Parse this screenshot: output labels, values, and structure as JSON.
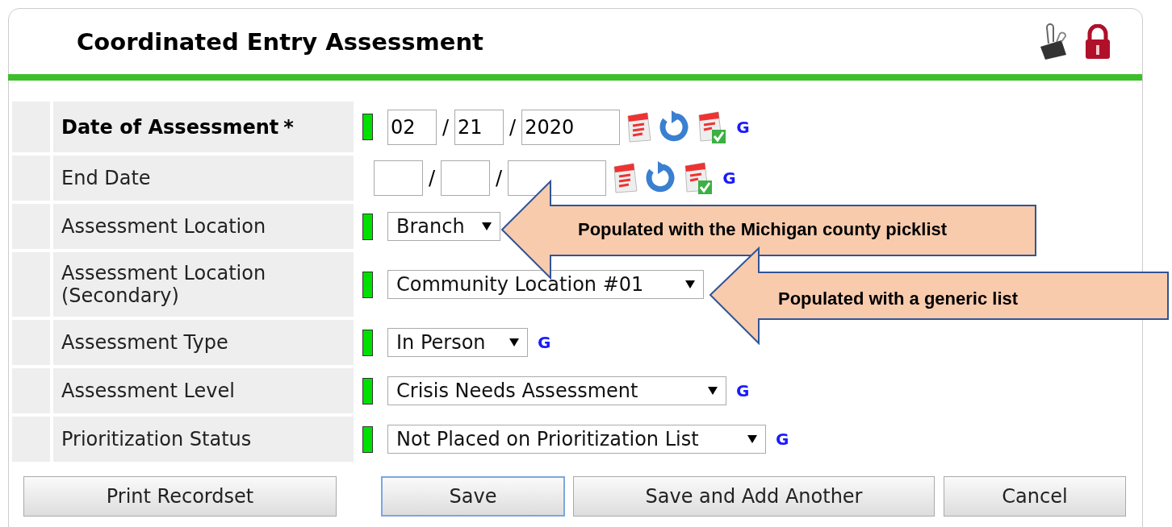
{
  "header": {
    "title": "Coordinated Entry Assessment"
  },
  "fields": [
    {
      "kind": "date",
      "label": "Date of Assessment",
      "asterisk": "*",
      "required": true,
      "month": "02",
      "day": "21",
      "year": "2020",
      "separators": [
        "/",
        "/"
      ],
      "g": "G"
    },
    {
      "kind": "date",
      "label": "End Date",
      "required": false,
      "separators": [
        "/",
        "/"
      ],
      "g": "G"
    },
    {
      "kind": "select",
      "label": "Assessment Location",
      "required": true,
      "value": "Branch"
    },
    {
      "kind": "select",
      "label": "Assessment Location (Secondary)",
      "required": true,
      "value": "Community Location #01"
    },
    {
      "kind": "select",
      "label": "Assessment Type",
      "required": true,
      "value": "In Person",
      "g": "G"
    },
    {
      "kind": "select",
      "label": "Assessment Level",
      "required": true,
      "value": "Crisis Needs Assessment",
      "g": "G"
    },
    {
      "kind": "select",
      "label": "Prioritization Status",
      "required": true,
      "value": "Not Placed on Prioritization List",
      "g": "G"
    }
  ],
  "buttons": [
    {
      "label": "Print Recordset",
      "focused": false
    },
    {
      "label": "Save",
      "focused": true
    },
    {
      "label": "Save and Add Another",
      "focused": false
    },
    {
      "label": "Cancel",
      "focused": false
    }
  ],
  "callouts": [
    {
      "text": "Populated with the Michigan county picklist"
    },
    {
      "text": "Populated with a generic list"
    }
  ]
}
